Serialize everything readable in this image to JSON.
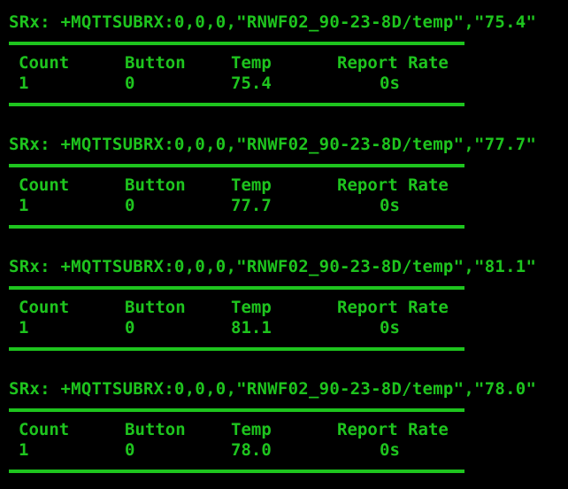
{
  "colors": {
    "background": "#000000",
    "text": "#1ec41e"
  },
  "headers": {
    "count": "Count",
    "button": "Button",
    "temp": "Temp",
    "rate": "Report Rate"
  },
  "messages": [
    {
      "srx": "SRx: +MQTTSUBRX:0,0,0,\"RNWF02_90-23-8D/temp\",\"75.4\"",
      "count": "1",
      "button": "0",
      "temp": "75.4",
      "rate": "0s"
    },
    {
      "srx": "SRx: +MQTTSUBRX:0,0,0,\"RNWF02_90-23-8D/temp\",\"77.7\"",
      "count": "1",
      "button": "0",
      "temp": "77.7",
      "rate": "0s"
    },
    {
      "srx": "SRx: +MQTTSUBRX:0,0,0,\"RNWF02_90-23-8D/temp\",\"81.1\"",
      "count": "1",
      "button": "0",
      "temp": "81.1",
      "rate": "0s"
    },
    {
      "srx": "SRx: +MQTTSUBRX:0,0,0,\"RNWF02_90-23-8D/temp\",\"78.0\"",
      "count": "1",
      "button": "0",
      "temp": "78.0",
      "rate": "0s"
    }
  ]
}
